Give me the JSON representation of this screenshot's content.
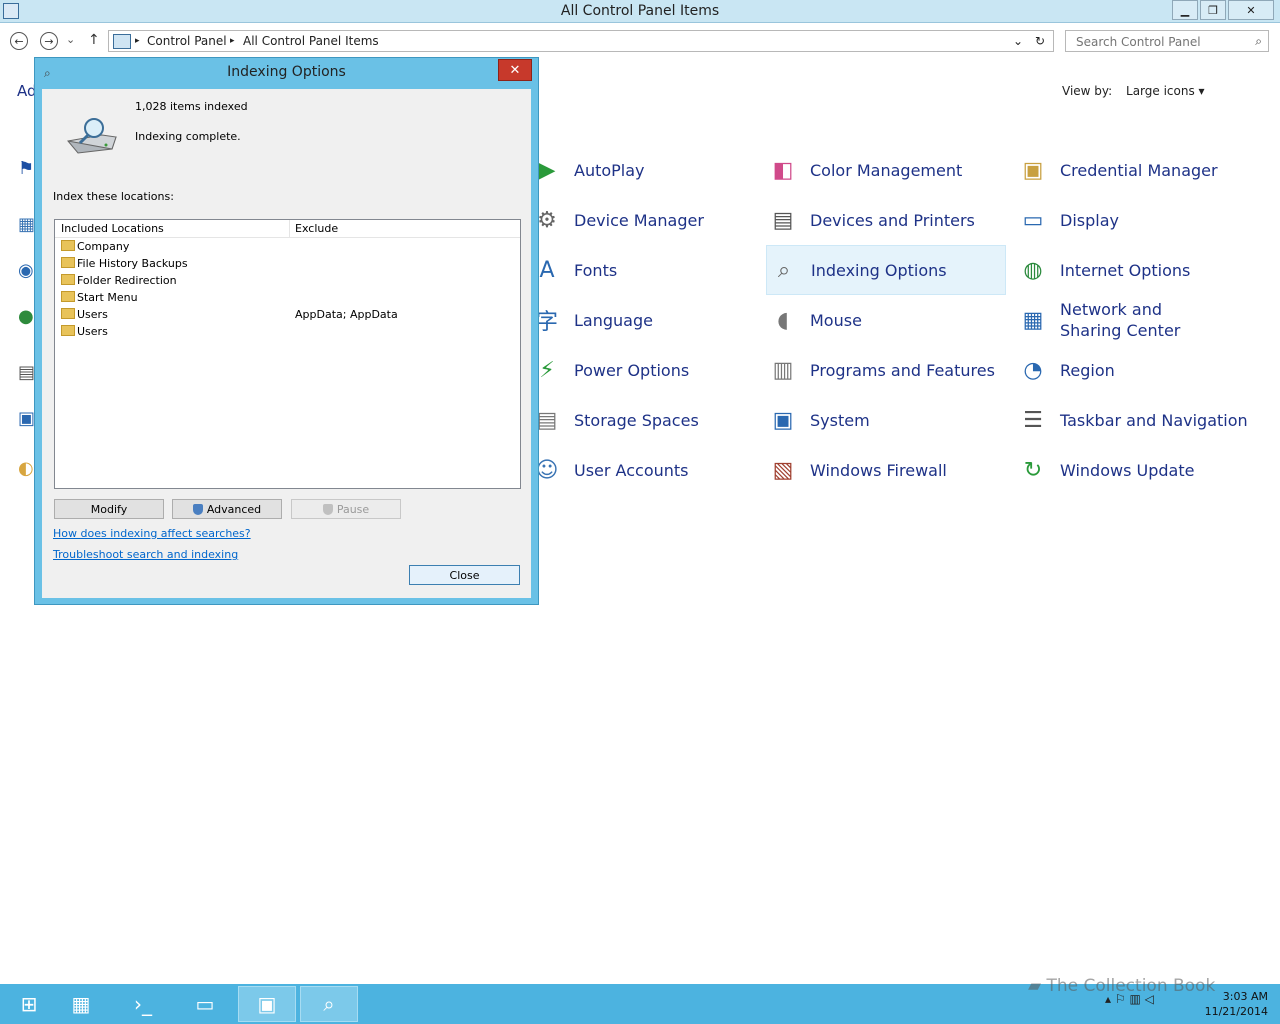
{
  "window": {
    "title": "All Control Panel Items",
    "minimize": "▁",
    "restore": "❐",
    "close": "✕"
  },
  "nav": {
    "back": "←",
    "forward": "→",
    "recent": "⌄",
    "up": "↑",
    "breadcrumb": [
      "Control Panel",
      "All Control Panel Items"
    ],
    "separator": "▸",
    "dropdown": "⌄",
    "refresh": "↻"
  },
  "search": {
    "placeholder": "Search Control Panel",
    "icon": "search-icon"
  },
  "viewby": {
    "label": "View by:",
    "selected": "Large icons ▾"
  },
  "items": [
    {
      "label": "AutoPlay",
      "icon": "autoplay-icon"
    },
    {
      "label": "Color Management",
      "icon": "color-management-icon"
    },
    {
      "label": "Credential Manager",
      "icon": "credential-manager-icon"
    },
    {
      "label": "Device Manager",
      "icon": "device-manager-icon"
    },
    {
      "label": "Devices and Printers",
      "icon": "printer-icon"
    },
    {
      "label": "Display",
      "icon": "display-icon"
    },
    {
      "label": "Fonts",
      "icon": "fonts-icon"
    },
    {
      "label": "Indexing Options",
      "icon": "indexing-icon"
    },
    {
      "label": "Internet Options",
      "icon": "internet-options-icon"
    },
    {
      "label": "Language",
      "icon": "language-icon"
    },
    {
      "label": "Mouse",
      "icon": "mouse-icon"
    },
    {
      "label": "Network and Sharing Center",
      "icon": "network-icon"
    },
    {
      "label": "Power Options",
      "icon": "power-icon"
    },
    {
      "label": "Programs and Features",
      "icon": "programs-icon"
    },
    {
      "label": "Region",
      "icon": "region-icon"
    },
    {
      "label": "Storage Spaces",
      "icon": "storage-icon"
    },
    {
      "label": "System",
      "icon": "system-icon"
    },
    {
      "label": "Taskbar and Navigation",
      "icon": "taskbar-icon"
    },
    {
      "label": "User Accounts",
      "icon": "user-icon"
    },
    {
      "label": "Windows Firewall",
      "icon": "firewall-icon"
    },
    {
      "label": "Windows Update",
      "icon": "update-icon"
    }
  ],
  "partial_left_label": "Ad",
  "dialog": {
    "title": "Indexing Options",
    "close": "✕",
    "items_indexed": "1,028 items indexed",
    "status": "Indexing complete.",
    "index_label": "Index these locations:",
    "col_included": "Included Locations",
    "col_exclude": "Exclude",
    "rows": [
      {
        "name": "Company",
        "exclude": ""
      },
      {
        "name": "File History Backups",
        "exclude": ""
      },
      {
        "name": "Folder Redirection",
        "exclude": ""
      },
      {
        "name": "Start Menu",
        "exclude": ""
      },
      {
        "name": "Users",
        "exclude": "AppData; AppData"
      },
      {
        "name": "Users",
        "exclude": ""
      }
    ],
    "modify": "Modify",
    "advanced": "Advanced",
    "pause": "Pause",
    "link1": "How does indexing affect searches?",
    "link2": "Troubleshoot search and indexing",
    "close_button": "Close"
  },
  "taskbar": {
    "time": "3:03 AM",
    "date": "11/21/2014",
    "watermark": "The Collection Book"
  },
  "colors": {
    "accent": "#4cb3e0",
    "link": "#1e3287",
    "dialog_frame": "#6ac1e6"
  }
}
